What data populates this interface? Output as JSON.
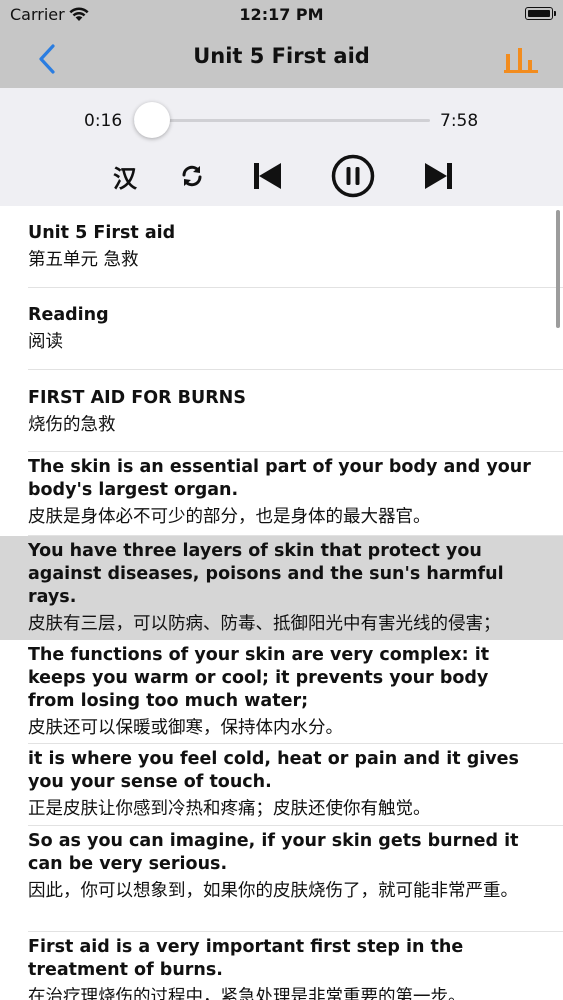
{
  "status_bar": {
    "carrier": "Carrier",
    "time": "12:17 PM"
  },
  "nav": {
    "title": "Unit 5 First aid",
    "back_icon": "chevron-left-icon",
    "right_icon": "bar-chart-icon",
    "accent": "#f28c1e",
    "back_color": "#2a7de1"
  },
  "player": {
    "current_time": "0:16",
    "duration": "7:58",
    "progress": 0.033,
    "translate_label": "汉",
    "controls": [
      "loop-icon",
      "previous-icon",
      "pause-icon",
      "next-icon"
    ]
  },
  "sentences": [
    {
      "en": "Unit 5 First aid",
      "zh": "第五单元 急救"
    },
    {
      "en": "Reading",
      "zh": "阅读"
    },
    {
      "en": "FIRST AID FOR BURNS",
      "zh": "烧伤的急救"
    },
    {
      "en": "The skin is an essential part of your body and your body's largest organ.",
      "zh": "皮肤是身体必不可少的部分，也是身体的最大器官。"
    },
    {
      "en": "You have three layers of skin that protect you against diseases, poisons and the sun's harmful rays.",
      "zh": "皮肤有三层，可以防病、防毒、抵御阳光中有害光线的侵害；",
      "highlighted": true
    },
    {
      "en": "The functions of your skin are very complex: it keeps you warm or cool; it prevents your body from losing too much water;",
      "zh": "皮肤还可以保暖或御寒，保持体内水分。"
    },
    {
      "en": "it is where you feel cold, heat or pain and it gives you your sense of touch.",
      "zh": "正是皮肤让你感到冷热和疼痛；皮肤还使你有触觉。"
    },
    {
      "en": "So as you can imagine, if your skin gets burned it can be very serious.",
      "zh": "因此，你可以想象到，如果你的皮肤烧伤了，就可能非常严重。"
    },
    {
      "en": "First aid is a very important first step in the treatment of burns.",
      "zh": "在治疗理烧伤的过程中，紧急处理是非常重要的第一步。"
    }
  ]
}
